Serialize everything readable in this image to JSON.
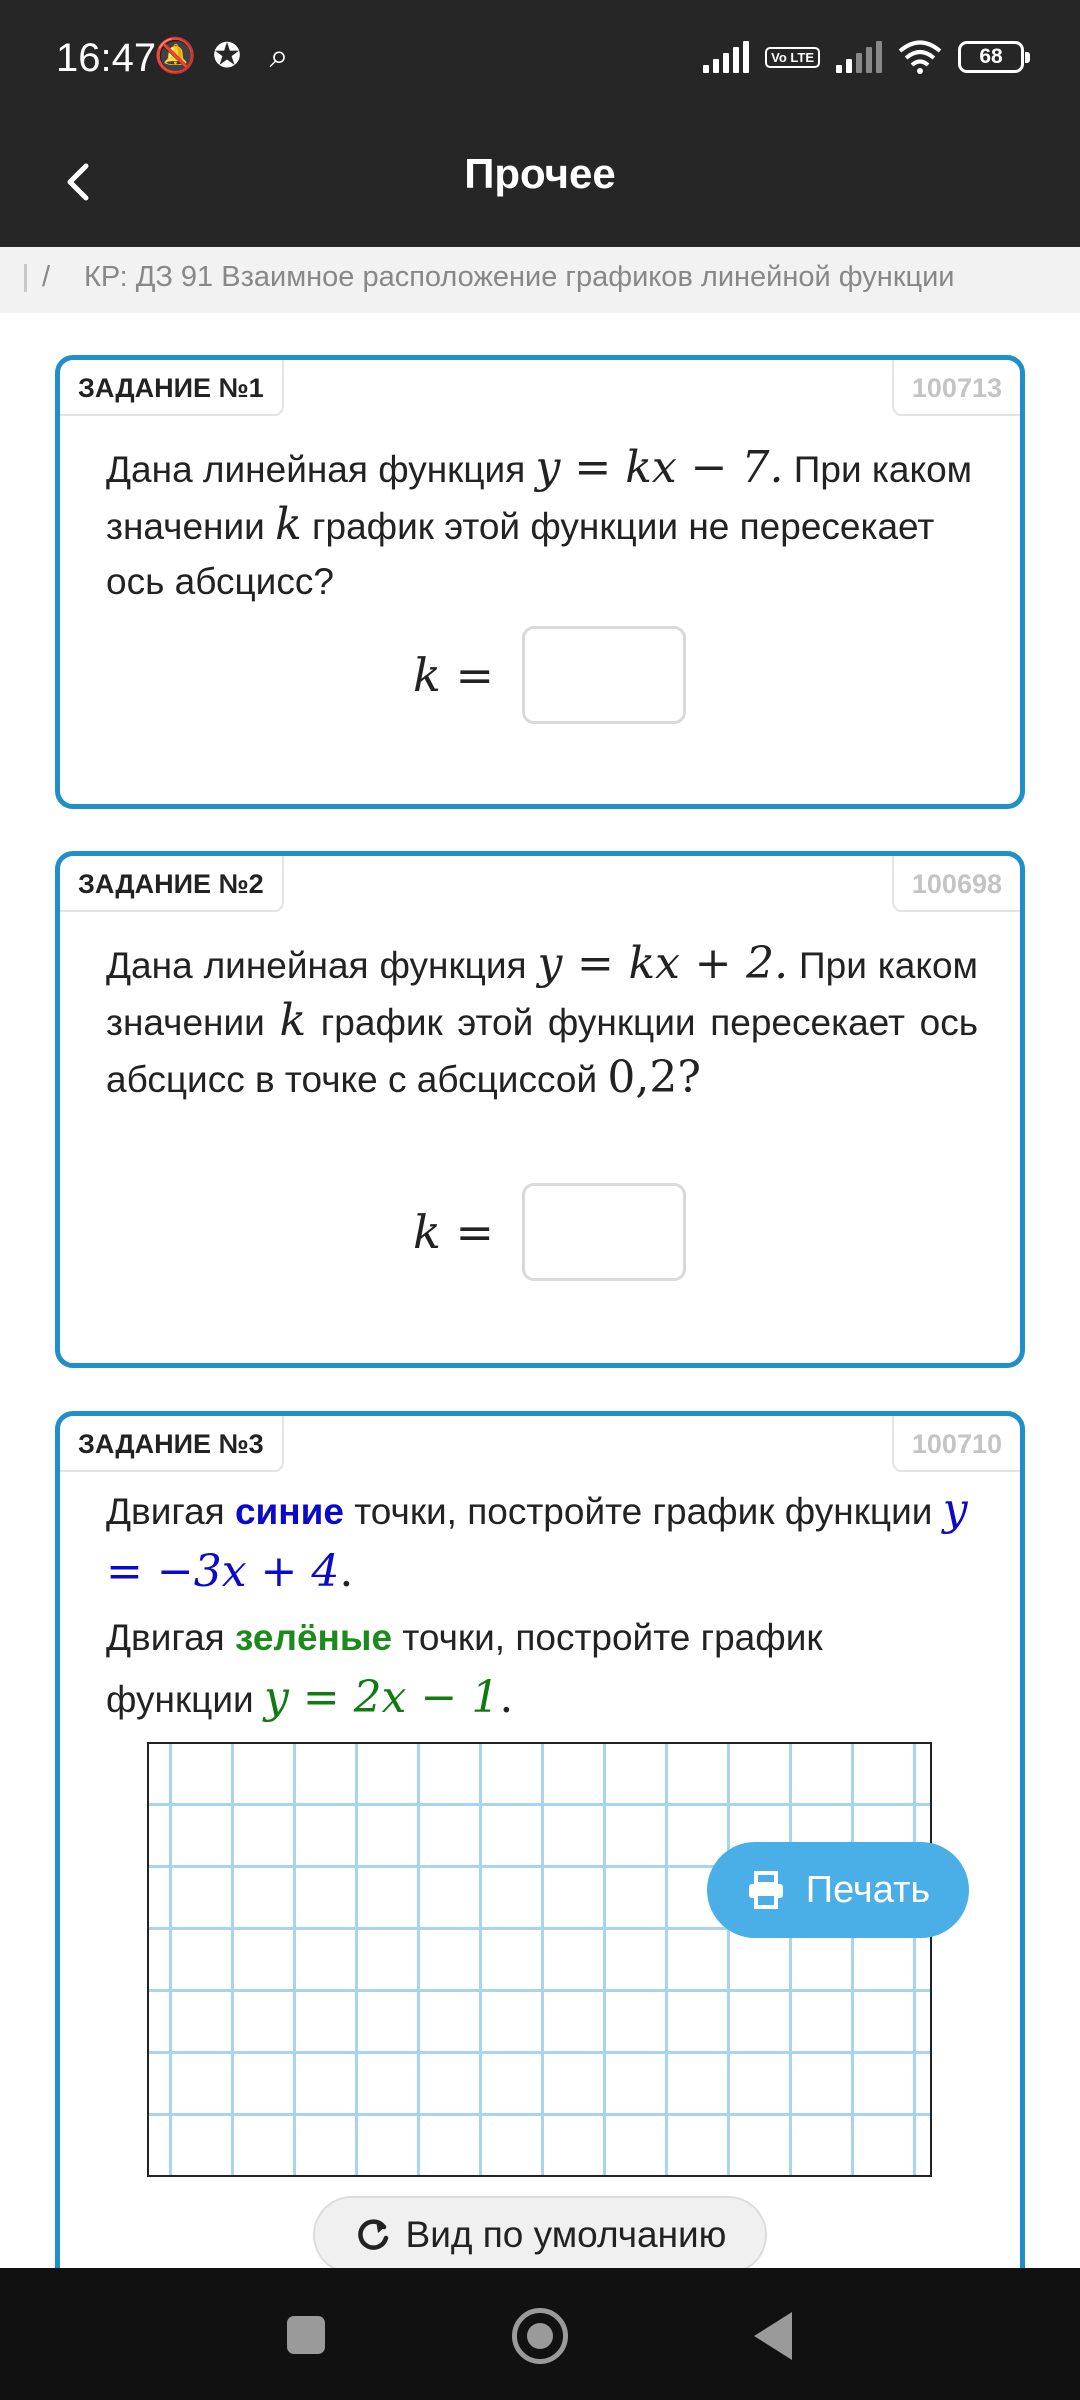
{
  "status_bar": {
    "time": "16:47",
    "battery": "68",
    "volte": "Vo LTE"
  },
  "app_bar": {
    "title": "Прочее"
  },
  "breadcrumb": {
    "separator": "/",
    "text": "КР: ДЗ 91 Взаимное расположение графиков линейной функции"
  },
  "tasks": [
    {
      "label": "ЗАДАНИЕ №1",
      "id": "100713",
      "t1": "Дана линейная функция ",
      "formula": "y = kx − 7.",
      "t2": " При каком значении ",
      "var": "k",
      "t3": " график этой функции не пересекает ось абсцисс?",
      "answer_var": "k",
      "answer_eq": "=",
      "answer_value": ""
    },
    {
      "label": "ЗАДАНИЕ №2",
      "id": "100698",
      "t1": "Дана линейная функция ",
      "formula": "y = kx + 2.",
      "t2": " При каком значении ",
      "var": "k",
      "t3": " график этой функции пересекает ось абсцисс в точке с абсциссой ",
      "value": "0,2?",
      "answer_var": "k",
      "answer_eq": "=",
      "answer_value": ""
    },
    {
      "label": "ЗАДАНИЕ №3",
      "id": "100710",
      "l1a": "Двигая ",
      "l1b": "синие",
      "l1c": " точки, постройте график функции ",
      "f1": "y = −3x + 4",
      "dot": ".",
      "l2a": "Двигая ",
      "l2b": "зелёные",
      "l2c": " точки, постройте график функции ",
      "f2": "y = 2x − 1"
    }
  ],
  "print_button": {
    "label": "Печать"
  },
  "reset_button": {
    "label": "Вид по умолчанию"
  },
  "colors": {
    "accent": "#1e8fc7",
    "blue_text": "#0a0ac8",
    "green_text": "#127a12",
    "print_button": "#4aafe6"
  }
}
